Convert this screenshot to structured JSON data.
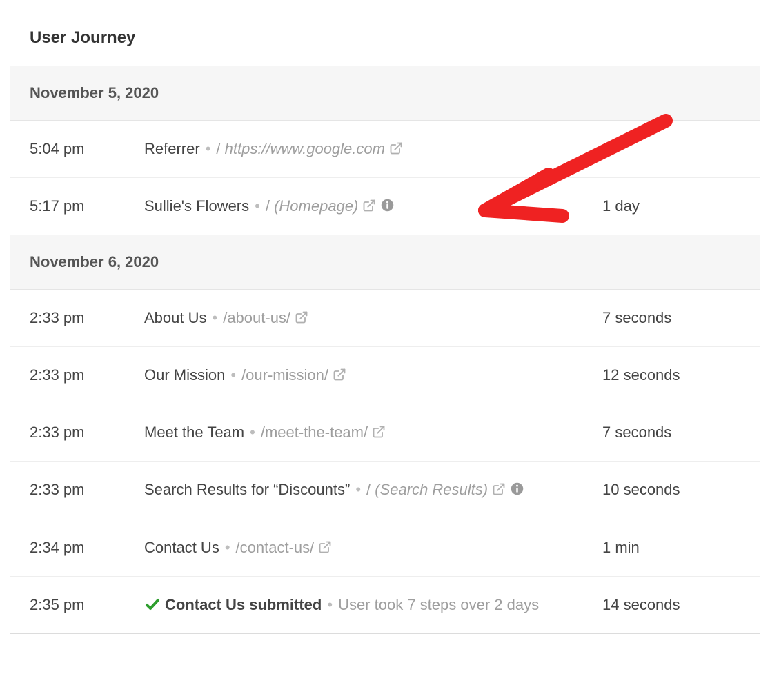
{
  "header": {
    "title": "User Journey"
  },
  "groups": [
    {
      "date": "November 5, 2020",
      "rows": [
        {
          "time": "5:04 pm",
          "title": "Referrer",
          "path_prefix": "/ ",
          "path": "https://www.google.com",
          "path_italic": true,
          "show_ext": true,
          "show_info": false,
          "duration": ""
        },
        {
          "time": "5:17 pm",
          "title": "Sullie's Flowers",
          "path_prefix": "/ ",
          "path": "(Homepage)",
          "path_italic": true,
          "show_ext": true,
          "show_info": true,
          "duration": "1 day"
        }
      ]
    },
    {
      "date": "November 6, 2020",
      "rows": [
        {
          "time": "2:33 pm",
          "title": "About Us",
          "path_prefix": "",
          "path": "/about-us/",
          "path_italic": false,
          "show_ext": true,
          "show_info": false,
          "duration": "7 seconds"
        },
        {
          "time": "2:33 pm",
          "title": "Our Mission",
          "path_prefix": "",
          "path": "/our-mission/",
          "path_italic": false,
          "show_ext": true,
          "show_info": false,
          "duration": "12 seconds"
        },
        {
          "time": "2:33 pm",
          "title": "Meet the Team",
          "path_prefix": "",
          "path": "/meet-the-team/",
          "path_italic": false,
          "show_ext": true,
          "show_info": false,
          "duration": "7 seconds"
        },
        {
          "time": "2:33 pm",
          "title": "Search Results for “Discounts”",
          "path_prefix": "/ ",
          "path": "(Search Results)",
          "path_italic": true,
          "show_ext": true,
          "show_info": true,
          "duration": "10 seconds"
        },
        {
          "time": "2:34 pm",
          "title": "Contact Us",
          "path_prefix": "",
          "path": "/contact-us/",
          "path_italic": false,
          "show_ext": true,
          "show_info": false,
          "duration": "1 min"
        },
        {
          "time": "2:35 pm",
          "title": "Contact Us submitted",
          "title_bold": true,
          "show_check": true,
          "meta": "User took 7 steps over 2 days",
          "duration": "14 seconds"
        }
      ]
    }
  ]
}
